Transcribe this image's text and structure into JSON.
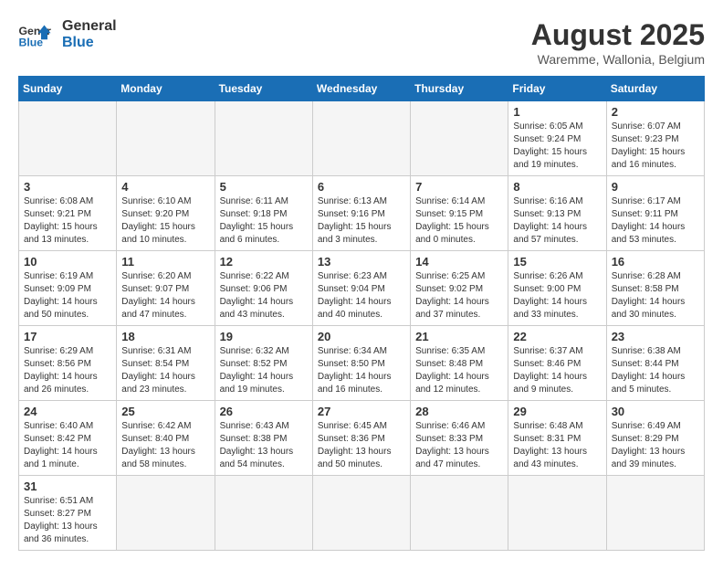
{
  "header": {
    "logo_general": "General",
    "logo_blue": "Blue",
    "month_year": "August 2025",
    "location": "Waremme, Wallonia, Belgium"
  },
  "weekdays": [
    "Sunday",
    "Monday",
    "Tuesday",
    "Wednesday",
    "Thursday",
    "Friday",
    "Saturday"
  ],
  "weeks": [
    {
      "days": [
        {
          "number": "",
          "info": ""
        },
        {
          "number": "",
          "info": ""
        },
        {
          "number": "",
          "info": ""
        },
        {
          "number": "",
          "info": ""
        },
        {
          "number": "",
          "info": ""
        },
        {
          "number": "1",
          "info": "Sunrise: 6:05 AM\nSunset: 9:24 PM\nDaylight: 15 hours\nand 19 minutes."
        },
        {
          "number": "2",
          "info": "Sunrise: 6:07 AM\nSunset: 9:23 PM\nDaylight: 15 hours\nand 16 minutes."
        }
      ]
    },
    {
      "days": [
        {
          "number": "3",
          "info": "Sunrise: 6:08 AM\nSunset: 9:21 PM\nDaylight: 15 hours\nand 13 minutes."
        },
        {
          "number": "4",
          "info": "Sunrise: 6:10 AM\nSunset: 9:20 PM\nDaylight: 15 hours\nand 10 minutes."
        },
        {
          "number": "5",
          "info": "Sunrise: 6:11 AM\nSunset: 9:18 PM\nDaylight: 15 hours\nand 6 minutes."
        },
        {
          "number": "6",
          "info": "Sunrise: 6:13 AM\nSunset: 9:16 PM\nDaylight: 15 hours\nand 3 minutes."
        },
        {
          "number": "7",
          "info": "Sunrise: 6:14 AM\nSunset: 9:15 PM\nDaylight: 15 hours\nand 0 minutes."
        },
        {
          "number": "8",
          "info": "Sunrise: 6:16 AM\nSunset: 9:13 PM\nDaylight: 14 hours\nand 57 minutes."
        },
        {
          "number": "9",
          "info": "Sunrise: 6:17 AM\nSunset: 9:11 PM\nDaylight: 14 hours\nand 53 minutes."
        }
      ]
    },
    {
      "days": [
        {
          "number": "10",
          "info": "Sunrise: 6:19 AM\nSunset: 9:09 PM\nDaylight: 14 hours\nand 50 minutes."
        },
        {
          "number": "11",
          "info": "Sunrise: 6:20 AM\nSunset: 9:07 PM\nDaylight: 14 hours\nand 47 minutes."
        },
        {
          "number": "12",
          "info": "Sunrise: 6:22 AM\nSunset: 9:06 PM\nDaylight: 14 hours\nand 43 minutes."
        },
        {
          "number": "13",
          "info": "Sunrise: 6:23 AM\nSunset: 9:04 PM\nDaylight: 14 hours\nand 40 minutes."
        },
        {
          "number": "14",
          "info": "Sunrise: 6:25 AM\nSunset: 9:02 PM\nDaylight: 14 hours\nand 37 minutes."
        },
        {
          "number": "15",
          "info": "Sunrise: 6:26 AM\nSunset: 9:00 PM\nDaylight: 14 hours\nand 33 minutes."
        },
        {
          "number": "16",
          "info": "Sunrise: 6:28 AM\nSunset: 8:58 PM\nDaylight: 14 hours\nand 30 minutes."
        }
      ]
    },
    {
      "days": [
        {
          "number": "17",
          "info": "Sunrise: 6:29 AM\nSunset: 8:56 PM\nDaylight: 14 hours\nand 26 minutes."
        },
        {
          "number": "18",
          "info": "Sunrise: 6:31 AM\nSunset: 8:54 PM\nDaylight: 14 hours\nand 23 minutes."
        },
        {
          "number": "19",
          "info": "Sunrise: 6:32 AM\nSunset: 8:52 PM\nDaylight: 14 hours\nand 19 minutes."
        },
        {
          "number": "20",
          "info": "Sunrise: 6:34 AM\nSunset: 8:50 PM\nDaylight: 14 hours\nand 16 minutes."
        },
        {
          "number": "21",
          "info": "Sunrise: 6:35 AM\nSunset: 8:48 PM\nDaylight: 14 hours\nand 12 minutes."
        },
        {
          "number": "22",
          "info": "Sunrise: 6:37 AM\nSunset: 8:46 PM\nDaylight: 14 hours\nand 9 minutes."
        },
        {
          "number": "23",
          "info": "Sunrise: 6:38 AM\nSunset: 8:44 PM\nDaylight: 14 hours\nand 5 minutes."
        }
      ]
    },
    {
      "days": [
        {
          "number": "24",
          "info": "Sunrise: 6:40 AM\nSunset: 8:42 PM\nDaylight: 14 hours\nand 1 minute."
        },
        {
          "number": "25",
          "info": "Sunrise: 6:42 AM\nSunset: 8:40 PM\nDaylight: 13 hours\nand 58 minutes."
        },
        {
          "number": "26",
          "info": "Sunrise: 6:43 AM\nSunset: 8:38 PM\nDaylight: 13 hours\nand 54 minutes."
        },
        {
          "number": "27",
          "info": "Sunrise: 6:45 AM\nSunset: 8:36 PM\nDaylight: 13 hours\nand 50 minutes."
        },
        {
          "number": "28",
          "info": "Sunrise: 6:46 AM\nSunset: 8:33 PM\nDaylight: 13 hours\nand 47 minutes."
        },
        {
          "number": "29",
          "info": "Sunrise: 6:48 AM\nSunset: 8:31 PM\nDaylight: 13 hours\nand 43 minutes."
        },
        {
          "number": "30",
          "info": "Sunrise: 6:49 AM\nSunset: 8:29 PM\nDaylight: 13 hours\nand 39 minutes."
        }
      ]
    },
    {
      "days": [
        {
          "number": "31",
          "info": "Sunrise: 6:51 AM\nSunset: 8:27 PM\nDaylight: 13 hours\nand 36 minutes."
        },
        {
          "number": "",
          "info": ""
        },
        {
          "number": "",
          "info": ""
        },
        {
          "number": "",
          "info": ""
        },
        {
          "number": "",
          "info": ""
        },
        {
          "number": "",
          "info": ""
        },
        {
          "number": "",
          "info": ""
        }
      ]
    }
  ]
}
